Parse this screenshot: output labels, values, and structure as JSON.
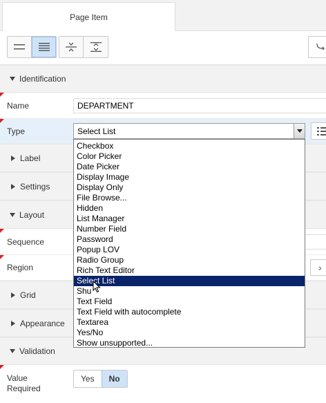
{
  "tabs": [
    {
      "label": "Page Item",
      "active": true
    }
  ],
  "toolbar": {
    "buttons": [
      {
        "icon": "lines-icon",
        "active": false
      },
      {
        "icon": "dense-lines-icon",
        "active": true
      },
      {
        "icon": "collapse-all-icon",
        "active": false
      },
      {
        "icon": "expand-all-icon",
        "active": false
      },
      {
        "icon": "go-to-icon",
        "active": false
      }
    ]
  },
  "sections": {
    "identification": "Identification",
    "label": "Label",
    "settings": "Settings",
    "layout": "Layout",
    "grid": "Grid",
    "appearance": "Appearance",
    "validation": "Validation"
  },
  "fields": {
    "name_label": "Name",
    "name_value": "DEPARTMENT",
    "type_label": "Type",
    "type_value": "Select List",
    "sequence_label": "Sequence",
    "region_label": "Region",
    "value_required_label_1": "Value",
    "value_required_label_2": "Required",
    "yes": "Yes",
    "no": "No"
  },
  "type_options": [
    "Checkbox",
    "Color Picker",
    "Date Picker",
    "Display Image",
    "Display Only",
    "File Browse...",
    "Hidden",
    "List Manager",
    "Number Field",
    "Password",
    "Popup LOV",
    "Radio Group",
    "Rich Text Editor",
    "Select List",
    "Shuttle",
    "Text Field",
    "Text Field with autocomplete",
    "Textarea",
    "Yes/No",
    "Show unsupported..."
  ],
  "type_options_selected": "Select List",
  "type_options_hover_display": "Shu",
  "colors": {
    "selected_option_bg": "#0a246a",
    "toggle_active": "#cfe3f8",
    "required_marker": "#e02020"
  }
}
